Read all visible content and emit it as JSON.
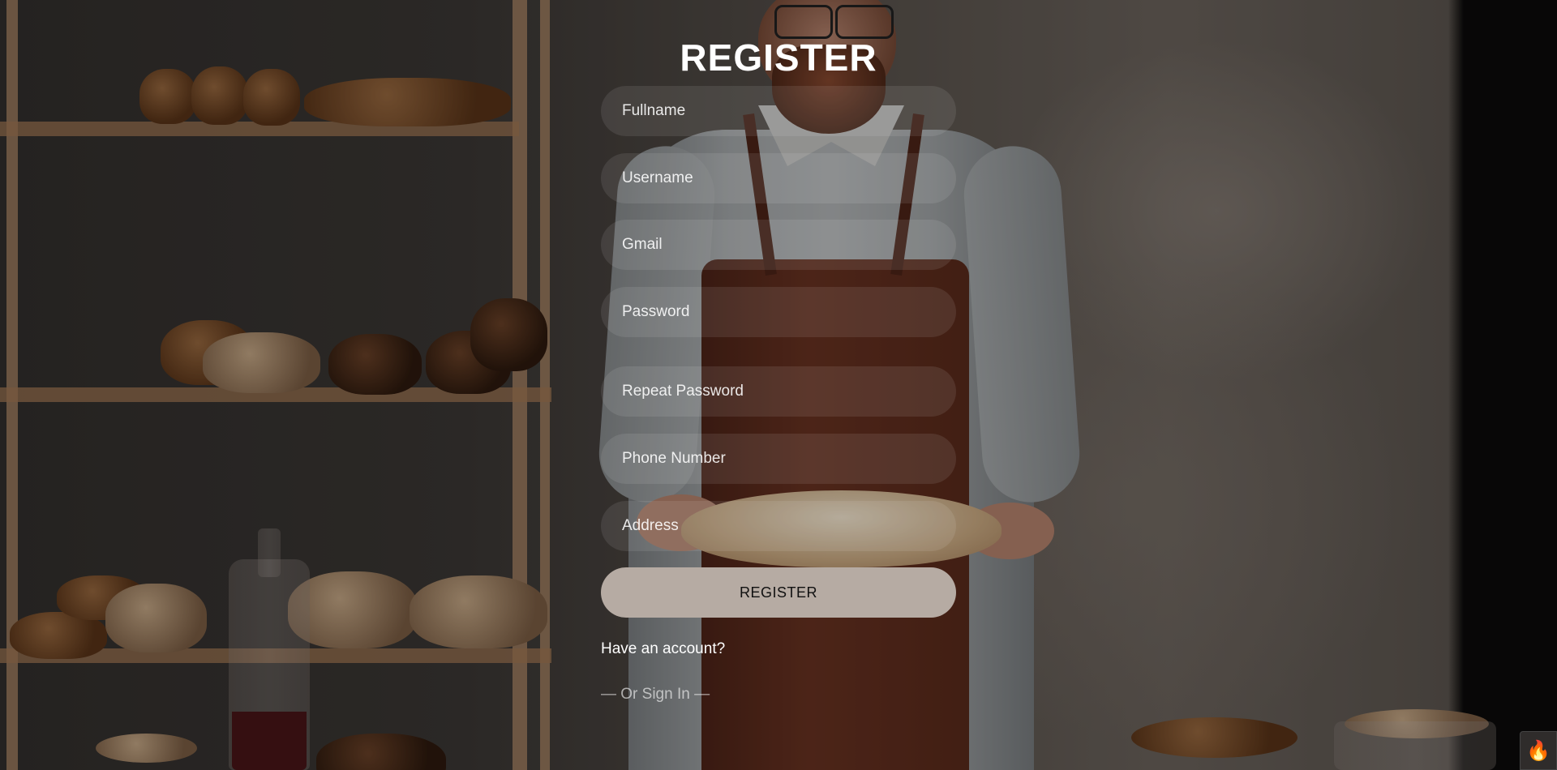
{
  "page": {
    "title": "REGISTER"
  },
  "form": {
    "fields": {
      "fullname": {
        "placeholder": "Fullname",
        "value": ""
      },
      "username": {
        "placeholder": "Username",
        "value": ""
      },
      "gmail": {
        "placeholder": "Gmail",
        "value": ""
      },
      "password": {
        "placeholder": "Password",
        "value": ""
      },
      "repeat_password": {
        "placeholder": "Repeat Password",
        "value": ""
      },
      "phone": {
        "placeholder": "Phone Number",
        "value": ""
      },
      "address": {
        "placeholder": "Address",
        "value": ""
      }
    },
    "submit_label": "REGISTER",
    "have_account": "Have an account?",
    "or_sign_in": "— Or Sign In —"
  },
  "badge": {
    "icon": "fire-icon",
    "glyph": "🔥"
  },
  "colors": {
    "button_bg": "#b6aba3",
    "field_bg": "rgba(255,255,255,0.09)",
    "text": "#ffffff"
  }
}
